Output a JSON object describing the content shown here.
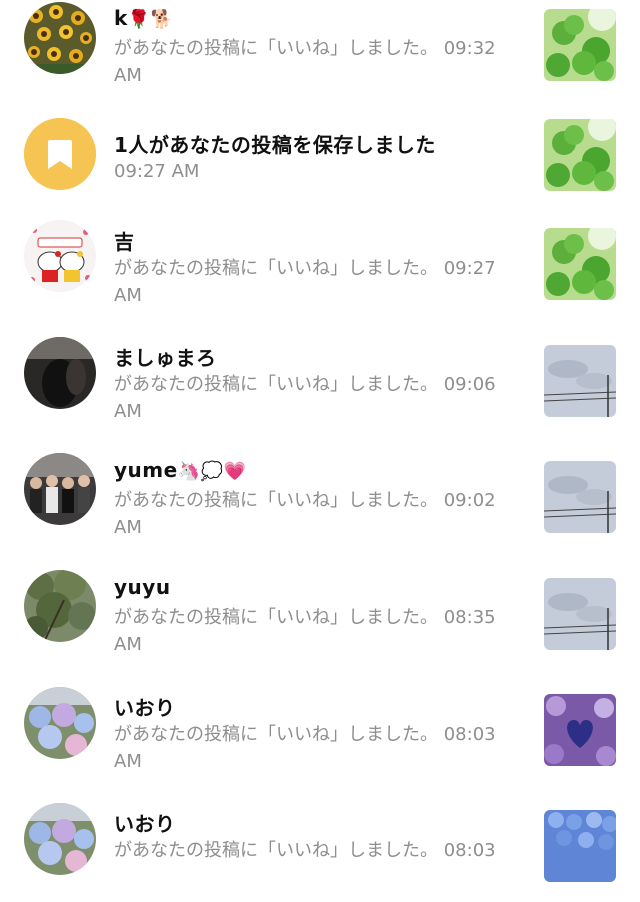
{
  "notifications": [
    {
      "name": "k",
      "emoji": "🌹🐕",
      "message": "があなたの投稿に「いいね」しました。 09:32",
      "time": "AM",
      "avatar_icon": "sunflowers-photo",
      "thumb_icon": "clover-photo"
    },
    {
      "name": "1人があなたの投稿を保存しました",
      "emoji": "",
      "message": "09:27 AM",
      "time": "",
      "avatar_icon": "bookmark-icon",
      "avatar_color": "#f6c453",
      "thumb_icon": "clover-photo"
    },
    {
      "name": "吉",
      "emoji": "",
      "message": "があなたの投稿に「いいね」しました。 09:27",
      "time": "AM",
      "avatar_icon": "hello-kitty-photo",
      "thumb_icon": "clover-photo"
    },
    {
      "name": "ましゅまろ",
      "emoji": "",
      "message": "があなたの投稿に「いいね」しました。 09:06",
      "time": "AM",
      "avatar_icon": "dark-photo",
      "thumb_icon": "sky-wires-photo"
    },
    {
      "name": "yume",
      "emoji": "🦄💭💗",
      "message": "があなたの投稿に「いいね」しました。 09:02",
      "time": "AM",
      "avatar_icon": "group-photo",
      "thumb_icon": "sky-wires-photo"
    },
    {
      "name": "yuyu",
      "emoji": "",
      "message": "があなたの投稿に「いいね」しました。 08:35",
      "time": "AM",
      "avatar_icon": "tree-photo",
      "thumb_icon": "sky-wires-photo"
    },
    {
      "name": "いおり",
      "emoji": "",
      "message": "があなたの投稿に「いいね」しました。 08:03",
      "time": "AM",
      "avatar_icon": "hydrangea-photo",
      "thumb_icon": "purple-heart-photo"
    },
    {
      "name": "いおり",
      "emoji": "",
      "message": "があなたの投稿に「いいね」しました。 08:03",
      "time": "",
      "avatar_icon": "hydrangea-photo",
      "thumb_icon": "blue-hydrangea-photo"
    }
  ]
}
